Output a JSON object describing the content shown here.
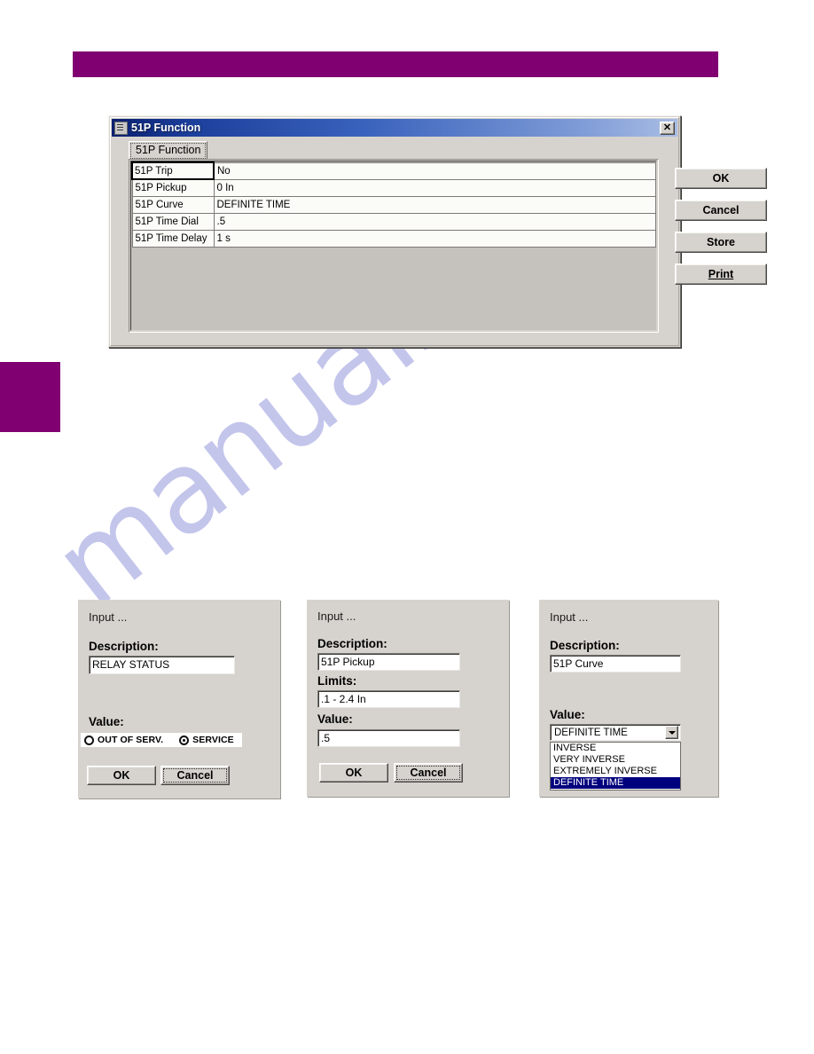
{
  "page": {
    "watermark_text": "manualshive.com",
    "accent_color": "#800071",
    "highlight_color": "#00007e"
  },
  "main_dialog": {
    "title": "51P Function",
    "close_label": "✕",
    "tab_label": "51P Function",
    "grid": {
      "rows": [
        {
          "name": "51P Trip",
          "value": "No"
        },
        {
          "name": "51P Pickup",
          "value": "0 In"
        },
        {
          "name": "51P Curve",
          "value": "DEFINITE TIME"
        },
        {
          "name": "51P Time Dial",
          "value": ".5"
        },
        {
          "name": "51P Time Delay",
          "value": "1 s"
        }
      ]
    },
    "buttons": {
      "ok": "OK",
      "cancel": "Cancel",
      "store": "Store",
      "print": "Print"
    }
  },
  "input_dialog_1": {
    "title": "Input ...",
    "description_label": "Description:",
    "description_value": "RELAY STATUS",
    "value_label": "Value:",
    "radios": [
      {
        "label": "OUT OF SERV.",
        "selected": false
      },
      {
        "label": "SERVICE",
        "selected": true
      }
    ],
    "ok_label": "OK",
    "cancel_label": "Cancel"
  },
  "input_dialog_2": {
    "title": "Input ...",
    "description_label": "Description:",
    "description_value": "51P Pickup",
    "limits_label": "Limits:",
    "limits_value": ".1 - 2.4 In",
    "value_label": "Value:",
    "value_value": ".5",
    "ok_label": "OK",
    "cancel_label": "Cancel"
  },
  "input_dialog_3": {
    "title": "Input ...",
    "description_label": "Description:",
    "description_value": "51P Curve",
    "value_label": "Value:",
    "combo_selected": "DEFINITE TIME",
    "combo_options": [
      {
        "label": "INVERSE",
        "selected": false
      },
      {
        "label": "VERY INVERSE",
        "selected": false
      },
      {
        "label": "EXTREMELY INVERSE",
        "selected": false
      },
      {
        "label": "DEFINITE TIME",
        "selected": true
      }
    ]
  }
}
